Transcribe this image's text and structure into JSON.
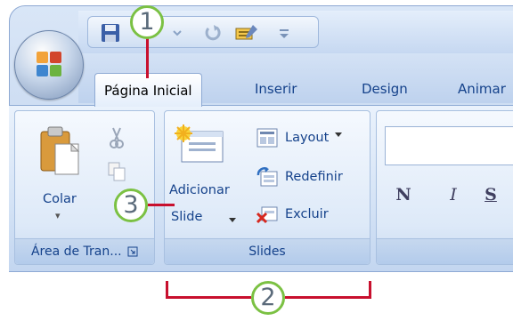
{
  "qat": {
    "icons": [
      "save-icon",
      "undo-icon",
      "redo-icon",
      "format-painter-icon",
      "customize-dropdown-icon"
    ]
  },
  "tabs": [
    {
      "label": "Página Inicial",
      "active": true
    },
    {
      "label": "Inserir",
      "active": false
    },
    {
      "label": "Design",
      "active": false
    },
    {
      "label": "Animar",
      "active": false
    }
  ],
  "groups": {
    "clipboard": {
      "label": "Área de Tran...",
      "paste_label": "Colar",
      "paste_dropdown": "▾"
    },
    "slides": {
      "label": "Slides",
      "add_slide_line1": "Adicionar",
      "add_slide_line2": "Slide",
      "layout": "Layout",
      "reset": "Redefinir",
      "delete": "Excluir"
    },
    "font": {
      "bold": "N",
      "italic": "I",
      "shadow": "S"
    }
  },
  "callouts": [
    "1",
    "2",
    "3"
  ],
  "colors": {
    "callout_border": "#7bc143",
    "callout_line": "#c8102e",
    "tab_text": "#15428b"
  }
}
